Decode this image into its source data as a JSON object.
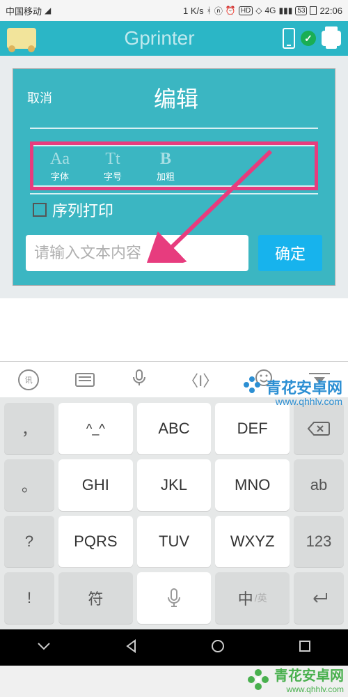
{
  "status": {
    "carrier": "中国移动",
    "speed": "1 K/s",
    "hd": "HD",
    "net": "4G",
    "battery": "53",
    "time": "22:06"
  },
  "app": {
    "title": "Gprinter"
  },
  "panel": {
    "cancel": "取消",
    "title": "编辑",
    "font_icon": "Aa",
    "font_label": "字体",
    "size_icon": "Tt",
    "size_label": "字号",
    "bold_icon": "B",
    "bold_label": "加粗",
    "sequence": "序列打印",
    "placeholder": "请输入文本内容",
    "confirm": "确定"
  },
  "ime": {
    "logo": "讯"
  },
  "keys": {
    "r1": {
      "a": "，",
      "b": "^_^",
      "c": "ABC",
      "d": "DEF"
    },
    "r2": {
      "a": "。",
      "b": "GHI",
      "c": "JKL",
      "d": "MNO",
      "e": "ab"
    },
    "r3": {
      "a": "?",
      "b": "PQRS",
      "c": "TUV",
      "d": "WXYZ",
      "e": "123"
    },
    "r4": {
      "a": "!",
      "b": "符",
      "d": "中",
      "d2": "/英"
    }
  },
  "watermark": {
    "name": "青花安卓网",
    "url": "www.qhhlv.com"
  }
}
